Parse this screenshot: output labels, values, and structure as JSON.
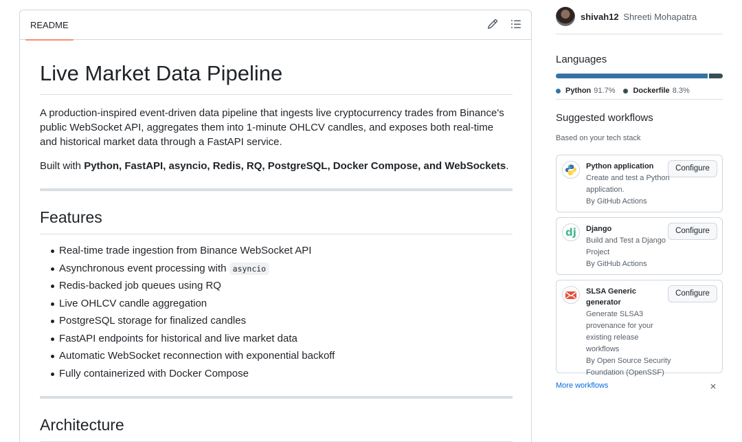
{
  "readme": {
    "tab_label": "README",
    "title": "Live Market Data Pipeline",
    "intro": "A production-inspired event-driven data pipeline that ingests live cryptocurrency trades from Binance's public WebSocket API, aggregates them into 1-minute OHLCV candles, and exposes both real-time and historical market data through a FastAPI service.",
    "built_prefix": "Built with ",
    "built_tech": "Python, FastAPI, asyncio, Redis, RQ, PostgreSQL, Docker Compose, and WebSockets",
    "built_suffix": ".",
    "features_heading": "Features",
    "features": [
      {
        "text": "Real-time trade ingestion from Binance WebSocket API"
      },
      {
        "text": "Asynchronous event processing with ",
        "code": "asyncio"
      },
      {
        "text": "Redis-backed job queues using RQ"
      },
      {
        "text": "Live OHLCV candle aggregation"
      },
      {
        "text": "PostgreSQL storage for finalized candles"
      },
      {
        "text": "FastAPI endpoints for historical and live market data"
      },
      {
        "text": "Automatic WebSocket reconnection with exponential backoff"
      },
      {
        "text": "Fully containerized with Docker Compose"
      }
    ],
    "architecture_heading": "Architecture",
    "icons": {
      "edit": "pencil-icon",
      "toc": "list-unordered-icon"
    }
  },
  "sidebar": {
    "author": {
      "login": "shivah12",
      "name": "Shreeti Mohapatra"
    },
    "languages": {
      "title": "Languages",
      "items": [
        {
          "name": "Python",
          "percent": "91.7%",
          "value": 91.7,
          "color": "#3572A5"
        },
        {
          "name": "Dockerfile",
          "percent": "8.3%",
          "value": 8.3,
          "color": "#384d54"
        }
      ]
    },
    "workflows": {
      "title": "Suggested workflows",
      "subtitle": "Based on your tech stack",
      "configure_label": "Configure",
      "items": [
        {
          "name": "Python application",
          "desc": [
            "Create and test a Python",
            "application."
          ],
          "by": "By GitHub Actions",
          "icon": "python-logo-icon"
        },
        {
          "name": "Django",
          "desc": [
            "Build and Test a Django",
            "Project"
          ],
          "by": "By GitHub Actions",
          "icon": "django-logo-icon"
        },
        {
          "name": "SLSA Generic generator",
          "desc": [
            "Generate SLSA3",
            "provenance for your",
            "existing release",
            "workflows"
          ],
          "by": "By Open Source Security Foundation (OpenSSF)",
          "by_lines": [
            "By Open Source Security",
            "Foundation (OpenSSF)"
          ],
          "icon": "slsa-logo-icon"
        }
      ],
      "more_label": "More workflows"
    }
  }
}
